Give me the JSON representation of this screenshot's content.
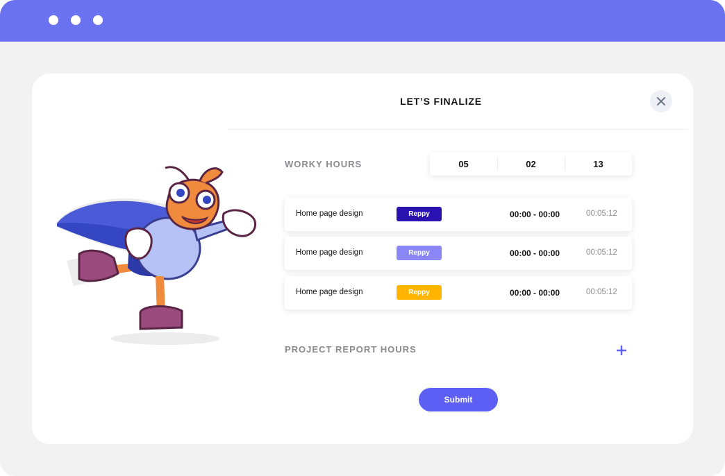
{
  "window": {
    "controls": [
      "dot",
      "dot",
      "dot"
    ]
  },
  "modal": {
    "title": "LET’S FINALIZE",
    "close_icon": "close-icon",
    "worky_hours": {
      "label": "WORKY HOURS",
      "values": [
        "05",
        "02",
        "13"
      ]
    },
    "tasks": [
      {
        "name": "Home page design",
        "tag": "Reppy",
        "tag_color": "#2a12b0",
        "range": "00:00 - 00:00",
        "duration": "00:05:12"
      },
      {
        "name": "Home page design",
        "tag": "Reppy",
        "tag_color": "#8b86f7",
        "range": "00:00 - 00:00",
        "duration": "00:05:12"
      },
      {
        "name": "Home page design",
        "tag": "Reppy",
        "tag_color": "#ffb400",
        "range": "00:00 - 00:00",
        "duration": "00:05:12"
      }
    ],
    "project_report": {
      "label": "PROJECT REPORT HOURS",
      "add_icon": "plus-icon"
    },
    "submit_label": "Submit"
  },
  "colors": {
    "titlebar": "#6b72ef",
    "accent": "#5d5ef3",
    "background": "#f2f2f2"
  }
}
